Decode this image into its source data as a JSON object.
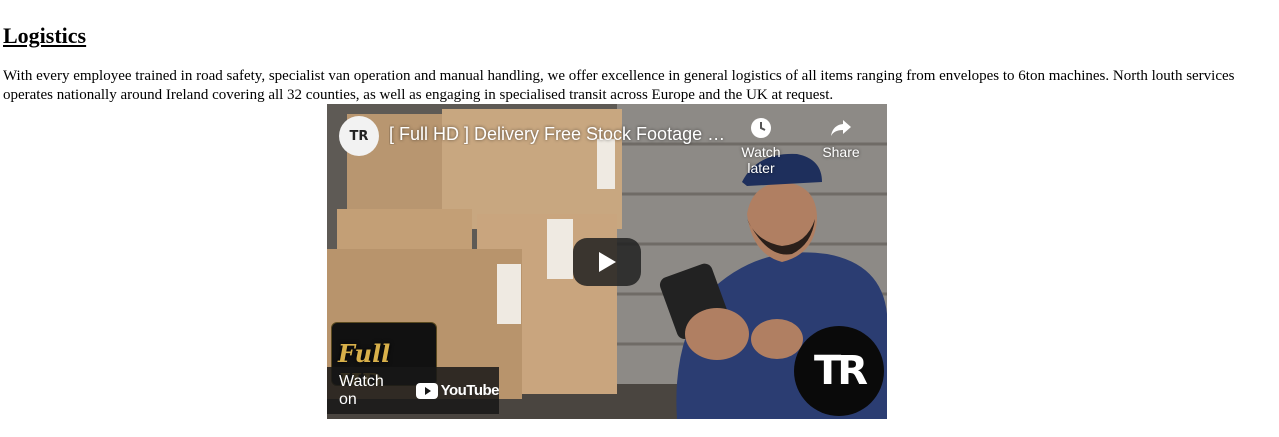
{
  "section": {
    "heading": "Logistics",
    "paragraph": "With every employee trained in road safety, specialist van operation and manual handling, we offer excellence in general logistics of all items ranging from envelopes to 6ton machines. North louth services operates nationally around Ireland covering all 32 counties, as well as engaging in specialised transit across Europe and the UK at request."
  },
  "video": {
    "channel_avatar_text": "TR",
    "title": "[ Full HD ] Delivery Free Stock Footage / Free Stock Video",
    "watch_later_label": "Watch later",
    "share_label": "Share",
    "watch_on_label": "Watch on",
    "youtube_label": "YouTube",
    "badge_text": "Full HD",
    "logo_text": "TR"
  },
  "colors": {
    "overlay": "#171717",
    "play_button": "#212121",
    "text_on_video": "#ffffff"
  }
}
